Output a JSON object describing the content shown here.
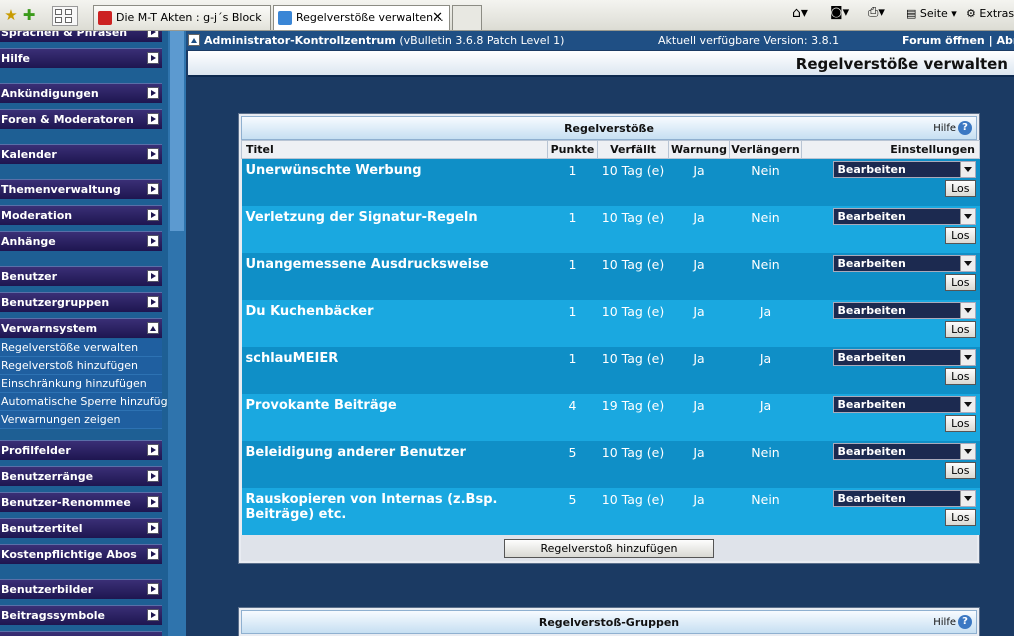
{
  "browser": {
    "tabs": [
      {
        "label": "Die M-T Akten : g-j´s Block"
      },
      {
        "label": "Regelverstöße verwalten..."
      }
    ],
    "right_menus": {
      "page": "Seite",
      "extras": "Extras"
    }
  },
  "sidebar": {
    "headers": [
      {
        "label": "Sprachen & Phrasen"
      },
      {
        "label": "Hilfe"
      },
      {
        "label": "Ankündigungen"
      },
      {
        "label": "Foren & Moderatoren"
      },
      {
        "label": "Kalender"
      },
      {
        "label": "Themenverwaltung"
      },
      {
        "label": "Moderation"
      },
      {
        "label": "Anhänge"
      },
      {
        "label": "Benutzer"
      },
      {
        "label": "Benutzergruppen"
      },
      {
        "label": "Verwarnsystem"
      },
      {
        "label": "Profilfelder"
      },
      {
        "label": "Benutzerränge"
      },
      {
        "label": "Benutzer-Renommee"
      },
      {
        "label": "Benutzertitel"
      },
      {
        "label": "Kostenpflichtige Abos"
      },
      {
        "label": "Benutzerbilder"
      },
      {
        "label": "Beitragssymbole"
      }
    ],
    "links": [
      {
        "label": "Regelverstöße verwalten"
      },
      {
        "label": "Regelverstoß hinzufügen"
      },
      {
        "label": "Einschränkung hinzufügen"
      },
      {
        "label": "Automatische Sperre hinzufügen"
      },
      {
        "label": "Verwarnungen zeigen"
      }
    ]
  },
  "topbar": {
    "title": "Administrator-Kontrollzentrum",
    "version": "(vBulletin 3.6.8 Patch Level 1)",
    "available": "Aktuell verfügbare Version: 3.8.1",
    "forum_link": "Forum öffnen",
    "separator": "|",
    "admin_link": "Abm"
  },
  "page_title": "Regelverstöße verwalten",
  "panel1": {
    "title": "Regelverstöße",
    "help": "Hilfe",
    "columns": {
      "title": "Titel",
      "points": "Punkte",
      "expires": "Verfällt",
      "warning": "Warnung",
      "extend": "Verlängern",
      "settings": "Einstellungen"
    },
    "rows": [
      {
        "title": "Unerwünschte Werbung",
        "points": "1",
        "expires": "10 Tag (e)",
        "warning": "Ja",
        "extend": "Nein"
      },
      {
        "title": "Verletzung der Signatur-Regeln",
        "points": "1",
        "expires": "10 Tag (e)",
        "warning": "Ja",
        "extend": "Nein"
      },
      {
        "title": "Unangemessene Ausdrucksweise",
        "points": "1",
        "expires": "10 Tag (e)",
        "warning": "Ja",
        "extend": "Nein"
      },
      {
        "title": "Du Kuchenbäcker",
        "points": "1",
        "expires": "10 Tag (e)",
        "warning": "Ja",
        "extend": "Ja"
      },
      {
        "title": "schlauMEIER",
        "points": "1",
        "expires": "10 Tag (e)",
        "warning": "Ja",
        "extend": "Ja"
      },
      {
        "title": "Provokante Beiträge",
        "points": "4",
        "expires": "19 Tag (e)",
        "warning": "Ja",
        "extend": "Ja"
      },
      {
        "title": "Beleidigung anderer Benutzer",
        "points": "5",
        "expires": "10 Tag (e)",
        "warning": "Ja",
        "extend": "Nein"
      },
      {
        "title": "Rauskopieren von Internas (z.Bsp. Beiträge) etc.",
        "points": "5",
        "expires": "10 Tag (e)",
        "warning": "Ja",
        "extend": "Nein"
      }
    ],
    "select_value": "Bearbeiten",
    "go_label": "Los",
    "add_button": "Regelverstoß hinzufügen"
  },
  "panel2": {
    "title": "Regelverstoß-Gruppen",
    "help": "Hilfe"
  }
}
